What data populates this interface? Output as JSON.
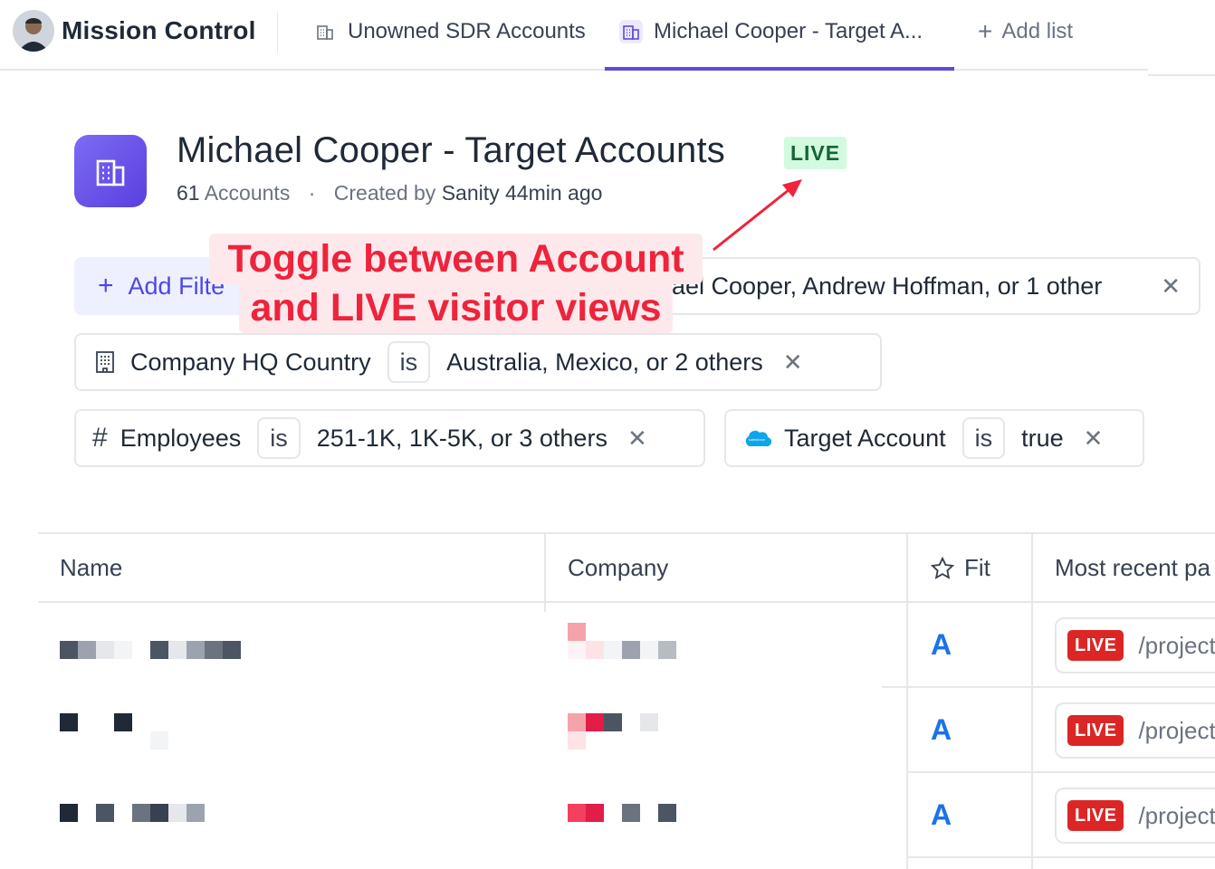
{
  "app": {
    "title": "Mission Control"
  },
  "tabs": [
    {
      "label": "Unowned SDR Accounts"
    },
    {
      "label": "Michael Cooper - Target A..."
    }
  ],
  "add_list_label": "Add list",
  "header": {
    "title": "Michael Cooper - Target Accounts",
    "badge": "LIVE",
    "count": "61",
    "count_suffix": "Accounts",
    "created_by_prefix": "Created by",
    "creator": "Sanity",
    "age": "44min ago"
  },
  "add_filter_label": "Add Filte",
  "filters": [
    {
      "label": "",
      "op": "",
      "value": "ael Cooper, Andrew Hoffman, or 1 other"
    },
    {
      "label": "Company HQ Country",
      "op": "is",
      "value": "Australia, Mexico, or 2 others"
    },
    {
      "label": "Employees",
      "op": "is",
      "value": "251-1K, 1K-5K, or 3 others"
    },
    {
      "label": "Target Account",
      "op": "is",
      "value": "true"
    }
  ],
  "annotation": {
    "line1": "Toggle between Account",
    "line2": "and LIVE visitor views"
  },
  "table": {
    "columns": [
      "Name",
      "Company",
      "Fit",
      "Most recent pa"
    ],
    "rows": [
      {
        "fit": "A",
        "live": "LIVE",
        "path": "/project"
      },
      {
        "fit": "A",
        "live": "LIVE",
        "path": "/project"
      },
      {
        "fit": "A",
        "live": "LIVE",
        "path": "/project"
      }
    ]
  },
  "colors": {
    "accent": "#5b4bdb",
    "live_green_bg": "#d1fadf",
    "live_red": "#dc2626",
    "annotation_red": "#ef233c",
    "fit_blue": "#1a73e8"
  },
  "icons": [
    "avatar",
    "building-icon",
    "plus-icon",
    "close-icon",
    "hash-icon",
    "salesforce-icon",
    "star-icon"
  ]
}
